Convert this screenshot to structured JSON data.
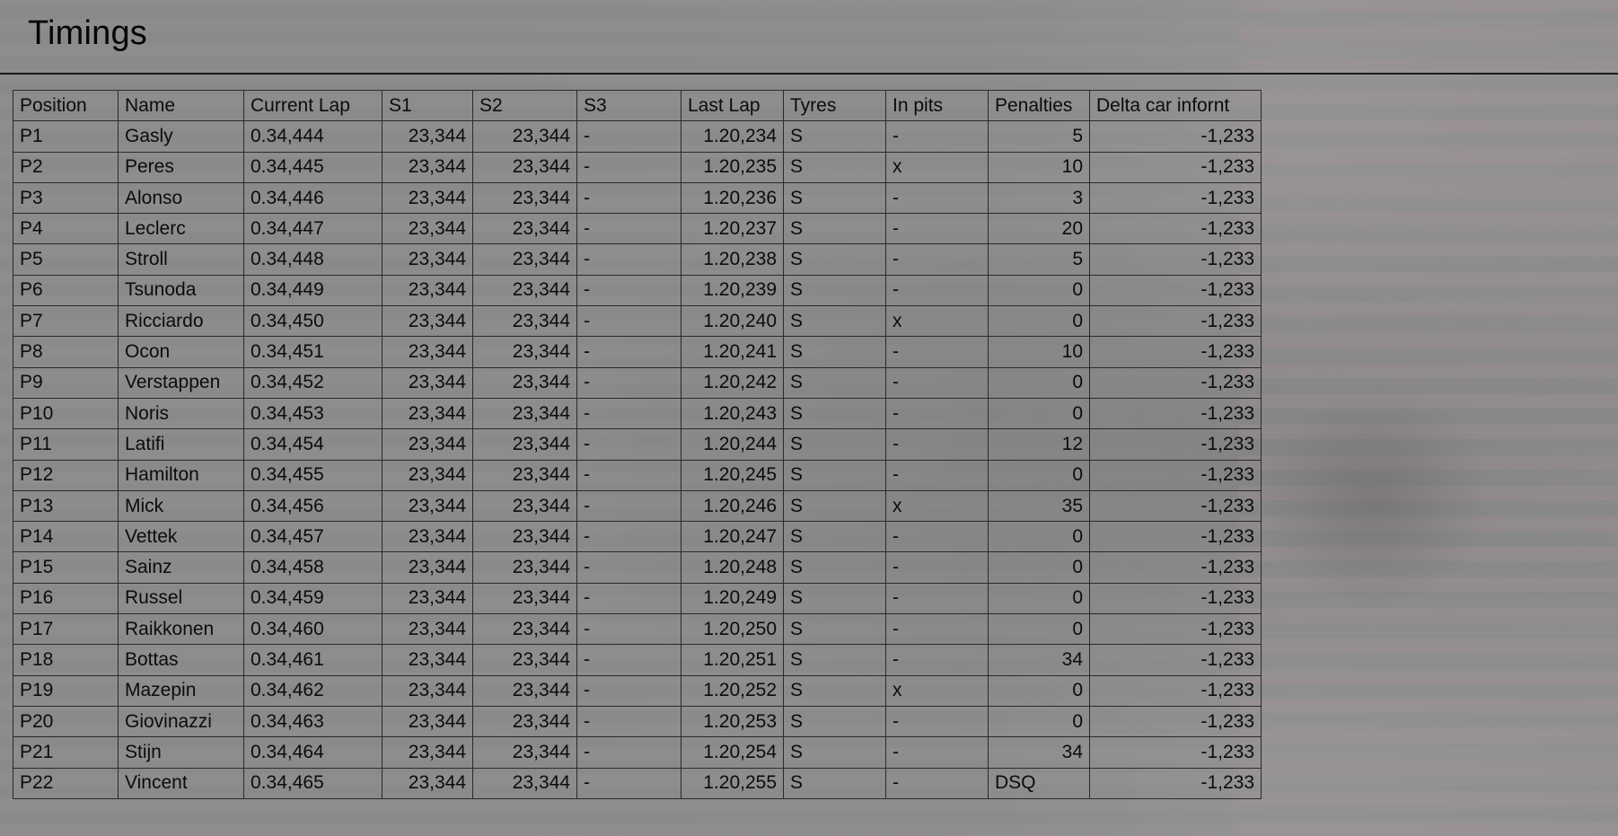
{
  "page": {
    "title": "Timings"
  },
  "table": {
    "columns": [
      "Position",
      "Name",
      "Current Lap",
      "S1",
      "S2",
      "S3",
      "Last Lap",
      "Tyres",
      "In pits",
      "Penalties",
      "Delta car infornt"
    ],
    "rows": [
      [
        "P1",
        "Gasly",
        "0.34,444",
        "23,344",
        "23,344",
        "-",
        "1.20,234",
        "S",
        "-",
        "5",
        "-1,233"
      ],
      [
        "P2",
        "Peres",
        "0.34,445",
        "23,344",
        "23,344",
        "-",
        "1.20,235",
        "S",
        "x",
        "10",
        "-1,233"
      ],
      [
        "P3",
        "Alonso",
        "0.34,446",
        "23,344",
        "23,344",
        "-",
        "1.20,236",
        "S",
        "-",
        "3",
        "-1,233"
      ],
      [
        "P4",
        "Leclerc",
        "0.34,447",
        "23,344",
        "23,344",
        "-",
        "1.20,237",
        "S",
        "-",
        "20",
        "-1,233"
      ],
      [
        "P5",
        "Stroll",
        "0.34,448",
        "23,344",
        "23,344",
        "-",
        "1.20,238",
        "S",
        "-",
        "5",
        "-1,233"
      ],
      [
        "P6",
        "Tsunoda",
        "0.34,449",
        "23,344",
        "23,344",
        "-",
        "1.20,239",
        "S",
        "-",
        "0",
        "-1,233"
      ],
      [
        "P7",
        "Ricciardo",
        "0.34,450",
        "23,344",
        "23,344",
        "-",
        "1.20,240",
        "S",
        "x",
        "0",
        "-1,233"
      ],
      [
        "P8",
        "Ocon",
        "0.34,451",
        "23,344",
        "23,344",
        "-",
        "1.20,241",
        "S",
        "-",
        "10",
        "-1,233"
      ],
      [
        "P9",
        "Verstappen",
        "0.34,452",
        "23,344",
        "23,344",
        "-",
        "1.20,242",
        "S",
        "-",
        "0",
        "-1,233"
      ],
      [
        "P10",
        "Noris",
        "0.34,453",
        "23,344",
        "23,344",
        "-",
        "1.20,243",
        "S",
        "-",
        "0",
        "-1,233"
      ],
      [
        "P11",
        "Latifi",
        "0.34,454",
        "23,344",
        "23,344",
        "-",
        "1.20,244",
        "S",
        "-",
        "12",
        "-1,233"
      ],
      [
        "P12",
        "Hamilton",
        "0.34,455",
        "23,344",
        "23,344",
        "-",
        "1.20,245",
        "S",
        "-",
        "0",
        "-1,233"
      ],
      [
        "P13",
        "Mick",
        "0.34,456",
        "23,344",
        "23,344",
        "-",
        "1.20,246",
        "S",
        "x",
        "35",
        "-1,233"
      ],
      [
        "P14",
        "Vettek",
        "0.34,457",
        "23,344",
        "23,344",
        "-",
        "1.20,247",
        "S",
        "-",
        "0",
        "-1,233"
      ],
      [
        "P15",
        "Sainz",
        "0.34,458",
        "23,344",
        "23,344",
        "-",
        "1.20,248",
        "S",
        "-",
        "0",
        "-1,233"
      ],
      [
        "P16",
        "Russel",
        "0.34,459",
        "23,344",
        "23,344",
        "-",
        "1.20,249",
        "S",
        "-",
        "0",
        "-1,233"
      ],
      [
        "P17",
        "Raikkonen",
        "0.34,460",
        "23,344",
        "23,344",
        "-",
        "1.20,250",
        "S",
        "-",
        "0",
        "-1,233"
      ],
      [
        "P18",
        "Bottas",
        "0.34,461",
        "23,344",
        "23,344",
        "-",
        "1.20,251",
        "S",
        "-",
        "34",
        "-1,233"
      ],
      [
        "P19",
        "Mazepin",
        "0.34,462",
        "23,344",
        "23,344",
        "-",
        "1.20,252",
        "S",
        "x",
        "0",
        "-1,233"
      ],
      [
        "P20",
        "Giovinazzi",
        "0.34,463",
        "23,344",
        "23,344",
        "-",
        "1.20,253",
        "S",
        "-",
        "0",
        "-1,233"
      ],
      [
        "P21",
        "Stijn",
        "0.34,464",
        "23,344",
        "23,344",
        "-",
        "1.20,254",
        "S",
        "-",
        "34",
        "-1,233"
      ],
      [
        "P22",
        "Vincent",
        "0.34,465",
        "23,344",
        "23,344",
        "-",
        "1.20,255",
        "S",
        "-",
        "DSQ",
        "-1,233"
      ]
    ]
  }
}
